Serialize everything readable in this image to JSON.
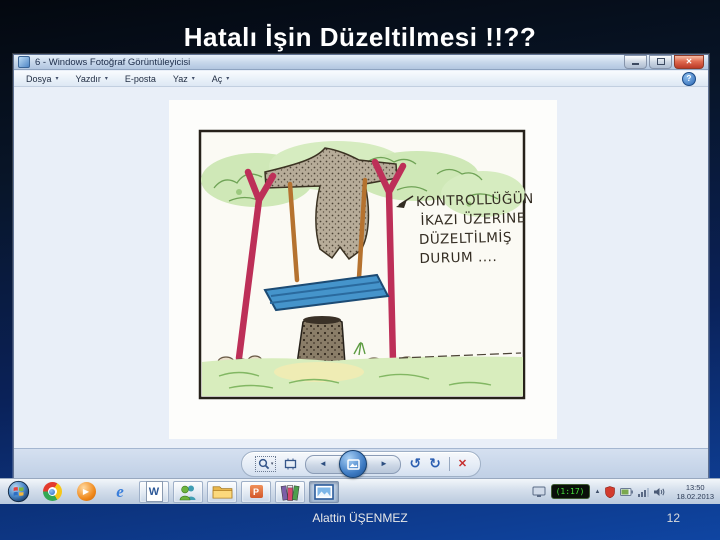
{
  "slide": {
    "title": "Hatalı İşin Düzeltilmesi !!??",
    "footer": {
      "author": "Alattin ÜŞENMEZ",
      "page_number": "12"
    }
  },
  "viewer": {
    "window_title": "6 - Windows Fotoğraf Görüntüleyicisi",
    "menu_items": [
      {
        "label": "Dosya",
        "arrow": "▾"
      },
      {
        "label": "Yazdır",
        "arrow": "▾"
      },
      {
        "label": "E-posta",
        "arrow": ""
      },
      {
        "label": "Yaz",
        "arrow": "▾"
      },
      {
        "label": "Aç",
        "arrow": "▾"
      }
    ],
    "help_label": "?",
    "toolbar": {
      "prev": "◄",
      "next": "►",
      "rotate_ccw": "↺",
      "rotate_cw": "↻",
      "delete": "✕"
    },
    "window_button_names": [
      "minimize",
      "maximize",
      "close"
    ]
  },
  "cartoon": {
    "caption_lines": [
      "KONTROLLÜĞÜN",
      "İKAZI ÜZERİNE",
      "DÜZELTİLMİŞ",
      "DURUM ...."
    ],
    "colors": {
      "support_pole": "#bd2f58",
      "rope": "#b5722f",
      "seat": "#4594cb",
      "canopy": "#cfe8b7",
      "grass": "#d8edbd"
    }
  },
  "taskbar": {
    "wmp_play": "▶",
    "ie_letter": "e",
    "word_letter": "W",
    "powerpoint_letter": "P",
    "tray": {
      "battery_widget": "(1:17)",
      "hidden_icons_chevron": "▲",
      "time": "13:50",
      "date": "18.02.2013"
    }
  }
}
